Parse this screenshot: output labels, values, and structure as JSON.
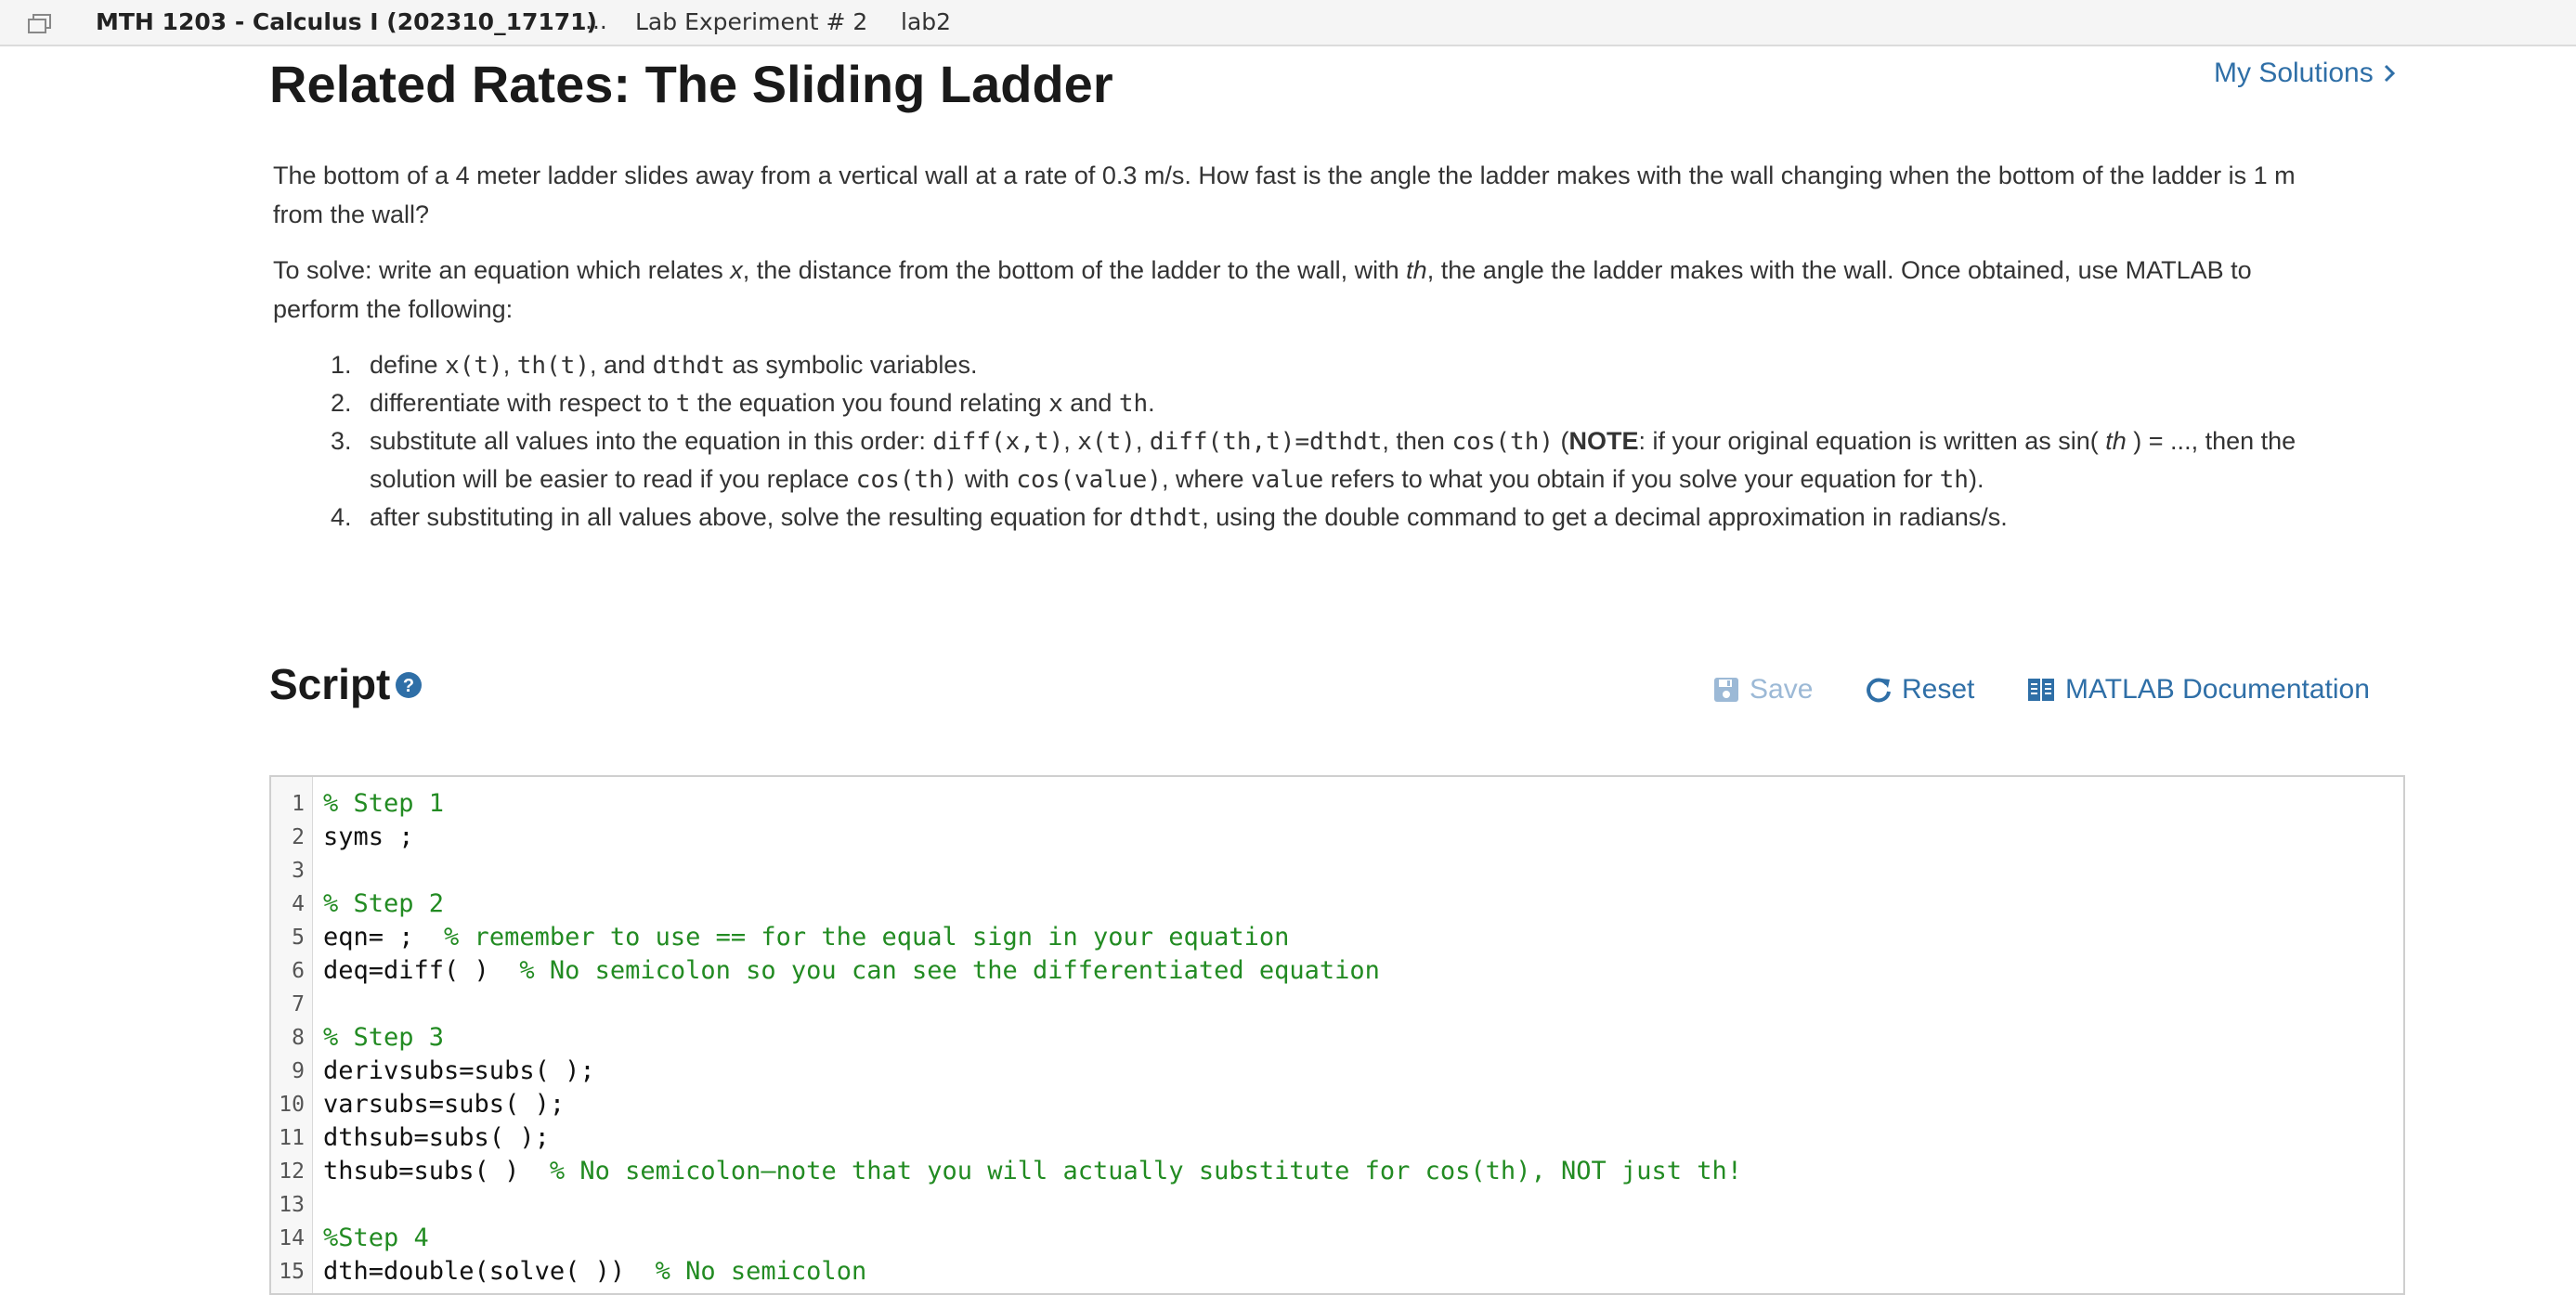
{
  "topbar": {
    "course": "MTH 1203 - Calculus I (202310_17171)",
    "ellipsis": "...",
    "crumb_lab": "Lab Experiment # 2",
    "crumb_file": "lab2"
  },
  "title": "Related Rates: The Sliding Ladder",
  "my_solutions": "My Solutions",
  "problem": {
    "p1": "The bottom of a 4 meter ladder slides away from a vertical wall at a rate of 0.3 m/s. How fast is the angle the ladder makes with the wall changing when the bottom of the ladder is 1 m from the wall?",
    "p2": {
      "a": "To solve: write an equation which relates ",
      "x": "x",
      "b": ", the distance from the bottom of the ladder to the wall, with ",
      "th": "th",
      "c": ", the angle the ladder makes with the wall. Once obtained, use MATLAB to perform the following:"
    }
  },
  "steps": [
    {
      "num": "1.",
      "t1": "define ",
      "c1": "x(t)",
      "t2": ", ",
      "c2": "th(t)",
      "t3": ", and ",
      "c3": "dthdt",
      "t4": " as symbolic variables."
    },
    {
      "num": "2.",
      "t1": "differentiate with respect to ",
      "c1": "t",
      "t2": " the equation you found relating ",
      "c2": "x",
      "t3": " and ",
      "c3": "th",
      "t4": "."
    },
    {
      "num": "3.",
      "t1": "substitute all values into the equation in this order: ",
      "c1": "diff(x,t)",
      "t2": ", ",
      "c2": "x(t)",
      "t3": ", ",
      "c3": "diff(th,t)=dthdt",
      "t4": ", then ",
      "c4": "cos(th)",
      "t5": " (",
      "note": "NOTE",
      "t6": ": if your original equation is written as sin( ",
      "i1": "th",
      "t7": " ) = ..., then the solution will be easier to read if you replace ",
      "c5": "cos(th)",
      "t8": " with ",
      "c6": "cos(value)",
      "t9": ", where ",
      "c7": "value",
      "t10": " refers to what you obtain if you solve your equation for ",
      "c8": "th",
      "t11": ")."
    },
    {
      "num": "4.",
      "t1": "after substituting in all values above, solve the resulting equation for ",
      "c1": "dthdt",
      "t2": ", using the double command to get a decimal approximation in radians/s."
    }
  ],
  "script": {
    "title": "Script",
    "save": "Save",
    "reset": "Reset",
    "docs": "MATLAB Documentation"
  },
  "code_lines": [
    {
      "n": "1",
      "code": "",
      "comment": "% Step 1"
    },
    {
      "n": "2",
      "code": "syms ;",
      "comment": ""
    },
    {
      "n": "3",
      "code": "",
      "comment": ""
    },
    {
      "n": "4",
      "code": "",
      "comment": "% Step 2"
    },
    {
      "n": "5",
      "code": "eqn= ;  ",
      "comment": "% remember to use == for the equal sign in your equation"
    },
    {
      "n": "6",
      "code": "deq=diff( )  ",
      "comment": "% No semicolon so you can see the differentiated equation"
    },
    {
      "n": "7",
      "code": "",
      "comment": ""
    },
    {
      "n": "8",
      "code": "",
      "comment": "% Step 3"
    },
    {
      "n": "9",
      "code": "derivsubs=subs( );",
      "comment": ""
    },
    {
      "n": "10",
      "code": "varsubs=subs( );",
      "comment": ""
    },
    {
      "n": "11",
      "code": "dthsub=subs( );",
      "comment": ""
    },
    {
      "n": "12",
      "code": "thsub=subs( )  ",
      "comment": "% No semicolon—note that you will actually substitute for cos(th), NOT just th!"
    },
    {
      "n": "13",
      "code": "",
      "comment": ""
    },
    {
      "n": "14",
      "code": "",
      "comment": "%Step 4"
    },
    {
      "n": "15",
      "code": "dth=double(solve( ))  ",
      "comment": "% No semicolon"
    }
  ]
}
